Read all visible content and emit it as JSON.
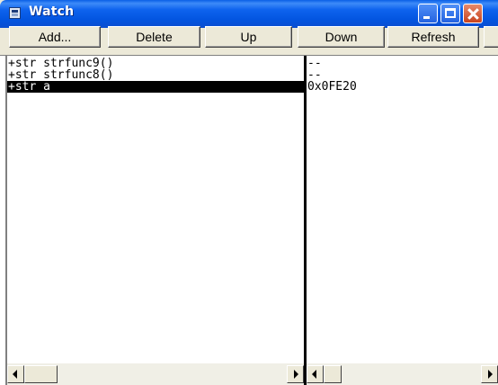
{
  "window": {
    "title": "Watch",
    "icon": "window-icon"
  },
  "toolbar": {
    "add_label": "Add...",
    "delete_label": "Delete",
    "up_label": "Up",
    "down_label": "Down",
    "refresh_label": "Refresh"
  },
  "watch": {
    "rows": [
      {
        "expression": "+str strfunc9()",
        "value": "--"
      },
      {
        "expression": "+str strfunc8()",
        "value": "--"
      },
      {
        "expression": "+str a",
        "value": "0x0FE20",
        "selected": true
      }
    ]
  },
  "colors": {
    "titlebar": "#0355e0",
    "selection": "#000000",
    "face": "#ece9d8"
  }
}
